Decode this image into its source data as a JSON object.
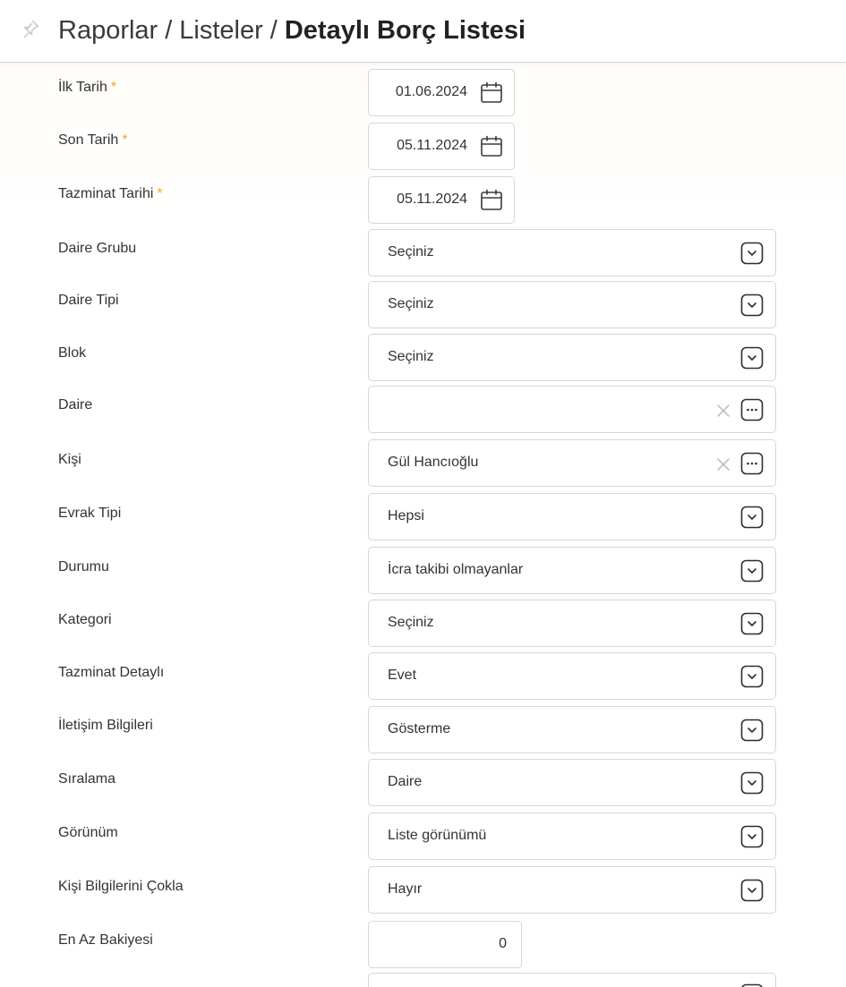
{
  "breadcrumb": {
    "part1": "Raporlar",
    "sep": "/",
    "part2": "Listeler",
    "current": "Detaylı Borç Listesi"
  },
  "required_mark": "*",
  "colors": {
    "required": "#f5a623",
    "border": "#d6d6d6",
    "text": "#333333"
  },
  "fields": {
    "ilk_tarih": {
      "label": "İlk Tarih",
      "value": "01.06.2024",
      "icon": "calendar-icon"
    },
    "son_tarih": {
      "label": "Son Tarih",
      "value": "05.11.2024",
      "icon": "calendar-icon"
    },
    "tazminat_tarihi": {
      "label": "Tazminat Tarihi",
      "value": "05.11.2024",
      "icon": "calendar-icon"
    },
    "daire_grubu": {
      "label": "Daire Grubu",
      "value": "Seçiniz",
      "icon": "chevron-down-icon"
    },
    "daire_tipi": {
      "label": "Daire Tipi",
      "value": "Seçiniz",
      "icon": "chevron-down-icon"
    },
    "blok": {
      "label": "Blok",
      "value": "Seçiniz",
      "icon": "chevron-down-icon"
    },
    "daire": {
      "label": "Daire",
      "value": "",
      "icon": "ellipsis-icon"
    },
    "kisi": {
      "label": "Kişi",
      "value": "Gül Hancıoğlu",
      "icon": "ellipsis-icon"
    },
    "evrak_tipi": {
      "label": "Evrak Tipi",
      "value": "Hepsi",
      "icon": "chevron-down-icon"
    },
    "durumu": {
      "label": "Durumu",
      "value": "İcra takibi olmayanlar",
      "icon": "chevron-down-icon"
    },
    "kategori": {
      "label": "Kategori",
      "value": "Seçiniz",
      "icon": "chevron-down-icon"
    },
    "tazminat_detayli": {
      "label": "Tazminat Detaylı",
      "value": "Evet",
      "icon": "chevron-down-icon"
    },
    "iletisim_bilgileri": {
      "label": "İletişim Bilgileri",
      "value": "Gösterme",
      "icon": "chevron-down-icon"
    },
    "siralama": {
      "label": "Sıralama",
      "value": "Daire",
      "icon": "chevron-down-icon"
    },
    "gorunum": {
      "label": "Görünüm",
      "value": "Liste görünümü",
      "icon": "chevron-down-icon"
    },
    "kisi_bilgilerini_cokla": {
      "label": "Kişi Bilgilerini Çokla",
      "value": "Hayır",
      "icon": "chevron-down-icon"
    },
    "en_az_bakiyesi": {
      "label": "En Az Bakiyesi",
      "value": "0"
    }
  }
}
